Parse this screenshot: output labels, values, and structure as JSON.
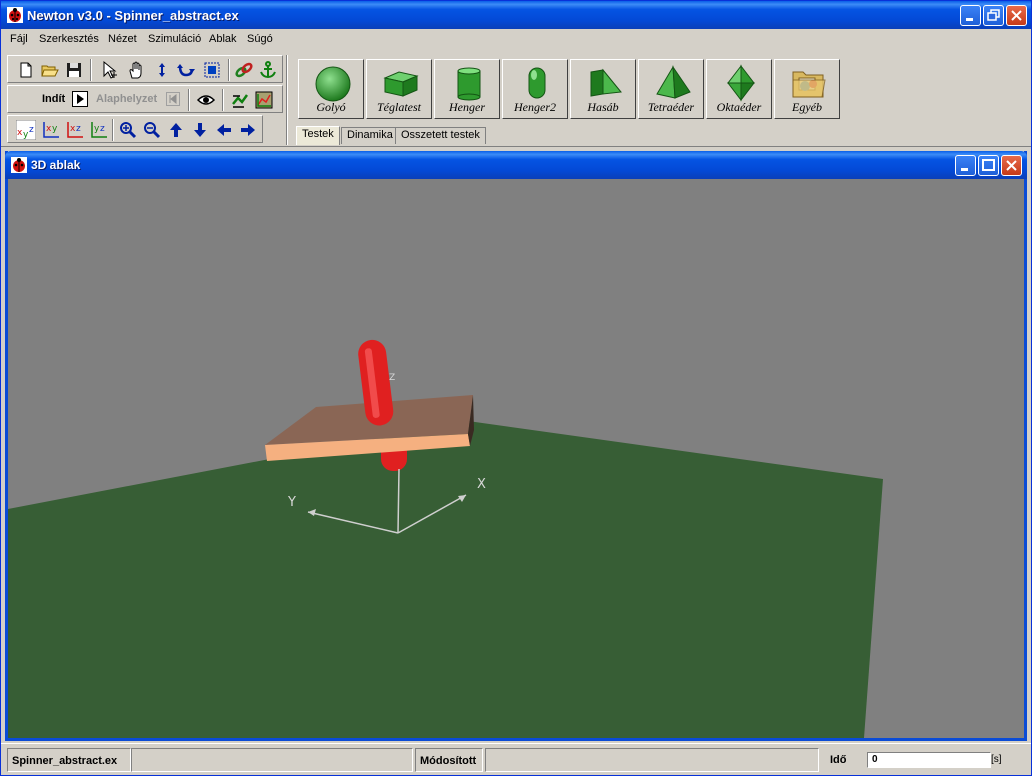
{
  "window": {
    "title": "Newton v3.0 - Spinner_abstract.ex"
  },
  "menu": [
    "Fájl",
    "Szerkesztés",
    "Nézet",
    "Szimuláció",
    "Ablak",
    "Súgó"
  ],
  "toolbar": {
    "start_label": "Indít",
    "reset_label": "Alaphelyzet"
  },
  "shapes": [
    {
      "label": "Golyó",
      "icon": "sphere-icon"
    },
    {
      "label": "Téglatest",
      "icon": "box-icon"
    },
    {
      "label": "Henger",
      "icon": "cylinder-icon"
    },
    {
      "label": "Henger2",
      "icon": "capsule-icon"
    },
    {
      "label": "Hasáb",
      "icon": "prism-icon"
    },
    {
      "label": "Tetraéder",
      "icon": "tetrahedron-icon"
    },
    {
      "label": "Oktaéder",
      "icon": "octahedron-icon"
    },
    {
      "label": "Egyéb",
      "icon": "folder-icon"
    }
  ],
  "tabs": [
    "Testek",
    "Dinamika",
    "Osszetett testek"
  ],
  "view3d": {
    "title": "3D ablak",
    "axis_x": "X",
    "axis_y": "Y",
    "axis_z": "Z"
  },
  "status": {
    "filename": "Spinner_abstract.ex",
    "modified": "Módosított",
    "time_label": "Idő",
    "time_value": "0",
    "time_unit": "[s]"
  },
  "colors": {
    "ground": "#375e35",
    "background": "#808080",
    "plate_top": "#8a6655",
    "plate_edge": "#f5b080",
    "rod": "#e02020",
    "shape_green": "#3aa83a"
  }
}
